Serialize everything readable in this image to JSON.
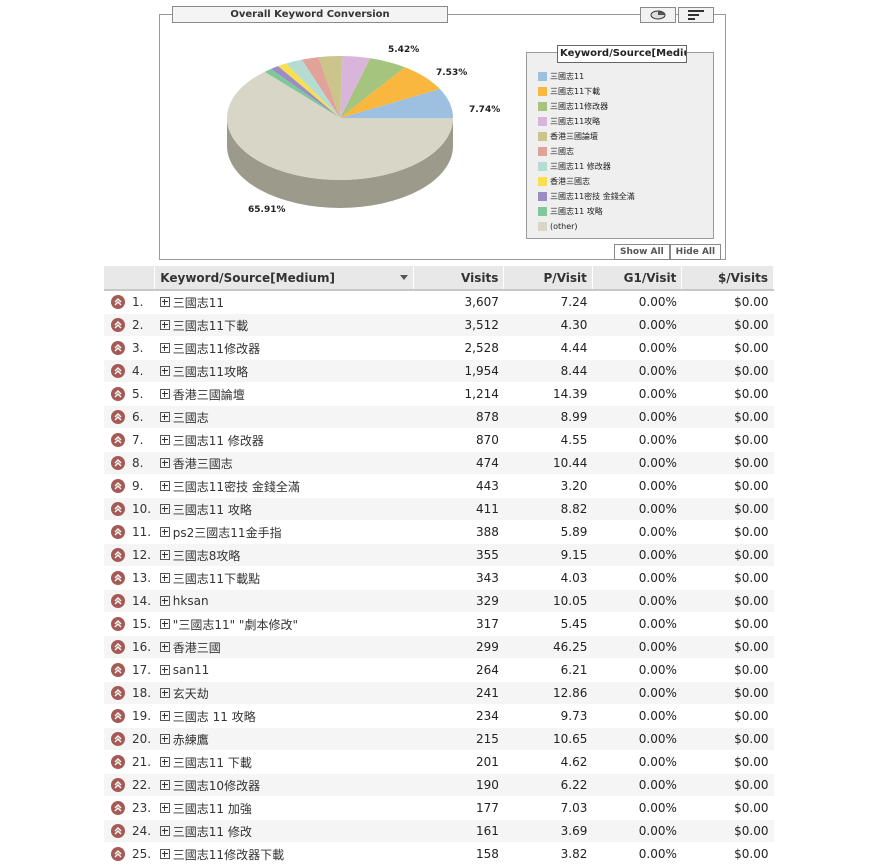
{
  "chart": {
    "title": "Overall Keyword Conversion",
    "legend_title": "Keyword/Source[Medium]",
    "show_all_label": "Show All",
    "hide_all_label": "Hide All",
    "slice_labels": {
      "s0": "7.74%",
      "s1": "7.53%",
      "s2": "5.42%",
      "other": "65.91%"
    },
    "legend": [
      {
        "label": "三國志11",
        "color": "#9dbfe0"
      },
      {
        "label": "三國志11下載",
        "color": "#f9b740"
      },
      {
        "label": "三國志11修改器",
        "color": "#a5c57e"
      },
      {
        "label": "三國志11攻略",
        "color": "#d9b5dc"
      },
      {
        "label": "香港三國論壇",
        "color": "#cbc58c"
      },
      {
        "label": "三國志",
        "color": "#e1a29a"
      },
      {
        "label": "三國志11 修改器",
        "color": "#b4dcd3"
      },
      {
        "label": "香港三國志",
        "color": "#f7df50"
      },
      {
        "label": "三國志11密技 金錢全滿",
        "color": "#9b8cc3"
      },
      {
        "label": "三國志11 攻略",
        "color": "#7ec89a"
      },
      {
        "label": "(other)",
        "color": "#d8d6c6"
      }
    ]
  },
  "table": {
    "headers": {
      "keyword": "Keyword/Source[Medium]",
      "visits": "Visits",
      "pvisit": "P/Visit",
      "g1visit": "G1/Visit",
      "dvisits": "$/Visits"
    },
    "rows": [
      {
        "rank": "1.",
        "kw": "三國志11",
        "visits": "3,607",
        "pv": "7.24",
        "g1": "0.00%",
        "dv": "$0.00"
      },
      {
        "rank": "2.",
        "kw": "三國志11下載",
        "visits": "3,512",
        "pv": "4.30",
        "g1": "0.00%",
        "dv": "$0.00"
      },
      {
        "rank": "3.",
        "kw": "三國志11修改器",
        "visits": "2,528",
        "pv": "4.44",
        "g1": "0.00%",
        "dv": "$0.00"
      },
      {
        "rank": "4.",
        "kw": "三國志11攻略",
        "visits": "1,954",
        "pv": "8.44",
        "g1": "0.00%",
        "dv": "$0.00"
      },
      {
        "rank": "5.",
        "kw": "香港三國論壇",
        "visits": "1,214",
        "pv": "14.39",
        "g1": "0.00%",
        "dv": "$0.00"
      },
      {
        "rank": "6.",
        "kw": "三國志",
        "visits": "878",
        "pv": "8.99",
        "g1": "0.00%",
        "dv": "$0.00"
      },
      {
        "rank": "7.",
        "kw": "三國志11 修改器",
        "visits": "870",
        "pv": "4.55",
        "g1": "0.00%",
        "dv": "$0.00"
      },
      {
        "rank": "8.",
        "kw": "香港三國志",
        "visits": "474",
        "pv": "10.44",
        "g1": "0.00%",
        "dv": "$0.00"
      },
      {
        "rank": "9.",
        "kw": "三國志11密技 金錢全滿",
        "visits": "443",
        "pv": "3.20",
        "g1": "0.00%",
        "dv": "$0.00"
      },
      {
        "rank": "10.",
        "kw": "三國志11 攻略",
        "visits": "411",
        "pv": "8.82",
        "g1": "0.00%",
        "dv": "$0.00"
      },
      {
        "rank": "11.",
        "kw": "ps2三國志11金手指",
        "visits": "388",
        "pv": "5.89",
        "g1": "0.00%",
        "dv": "$0.00"
      },
      {
        "rank": "12.",
        "kw": "三國志8攻略",
        "visits": "355",
        "pv": "9.15",
        "g1": "0.00%",
        "dv": "$0.00"
      },
      {
        "rank": "13.",
        "kw": "三國志11下載點",
        "visits": "343",
        "pv": "4.03",
        "g1": "0.00%",
        "dv": "$0.00"
      },
      {
        "rank": "14.",
        "kw": "hksan",
        "visits": "329",
        "pv": "10.05",
        "g1": "0.00%",
        "dv": "$0.00"
      },
      {
        "rank": "15.",
        "kw": "\"三國志11\" \"劇本修改\"",
        "visits": "317",
        "pv": "5.45",
        "g1": "0.00%",
        "dv": "$0.00"
      },
      {
        "rank": "16.",
        "kw": "香港三國",
        "visits": "299",
        "pv": "46.25",
        "g1": "0.00%",
        "dv": "$0.00"
      },
      {
        "rank": "17.",
        "kw": "san11",
        "visits": "264",
        "pv": "6.21",
        "g1": "0.00%",
        "dv": "$0.00"
      },
      {
        "rank": "18.",
        "kw": "玄天劫",
        "visits": "241",
        "pv": "12.86",
        "g1": "0.00%",
        "dv": "$0.00"
      },
      {
        "rank": "19.",
        "kw": "三國志 11 攻略",
        "visits": "234",
        "pv": "9.73",
        "g1": "0.00%",
        "dv": "$0.00"
      },
      {
        "rank": "20.",
        "kw": "赤練鷹",
        "visits": "215",
        "pv": "10.65",
        "g1": "0.00%",
        "dv": "$0.00"
      },
      {
        "rank": "21.",
        "kw": "三國志11 下載",
        "visits": "201",
        "pv": "4.62",
        "g1": "0.00%",
        "dv": "$0.00"
      },
      {
        "rank": "22.",
        "kw": "三國志10修改器",
        "visits": "190",
        "pv": "6.22",
        "g1": "0.00%",
        "dv": "$0.00"
      },
      {
        "rank": "23.",
        "kw": "三國志11 加強",
        "visits": "177",
        "pv": "7.03",
        "g1": "0.00%",
        "dv": "$0.00"
      },
      {
        "rank": "24.",
        "kw": "三國志11 修改",
        "visits": "161",
        "pv": "3.69",
        "g1": "0.00%",
        "dv": "$0.00"
      },
      {
        "rank": "25.",
        "kw": "三國志11修改器下載",
        "visits": "158",
        "pv": "3.82",
        "g1": "0.00%",
        "dv": "$0.00"
      }
    ]
  }
}
